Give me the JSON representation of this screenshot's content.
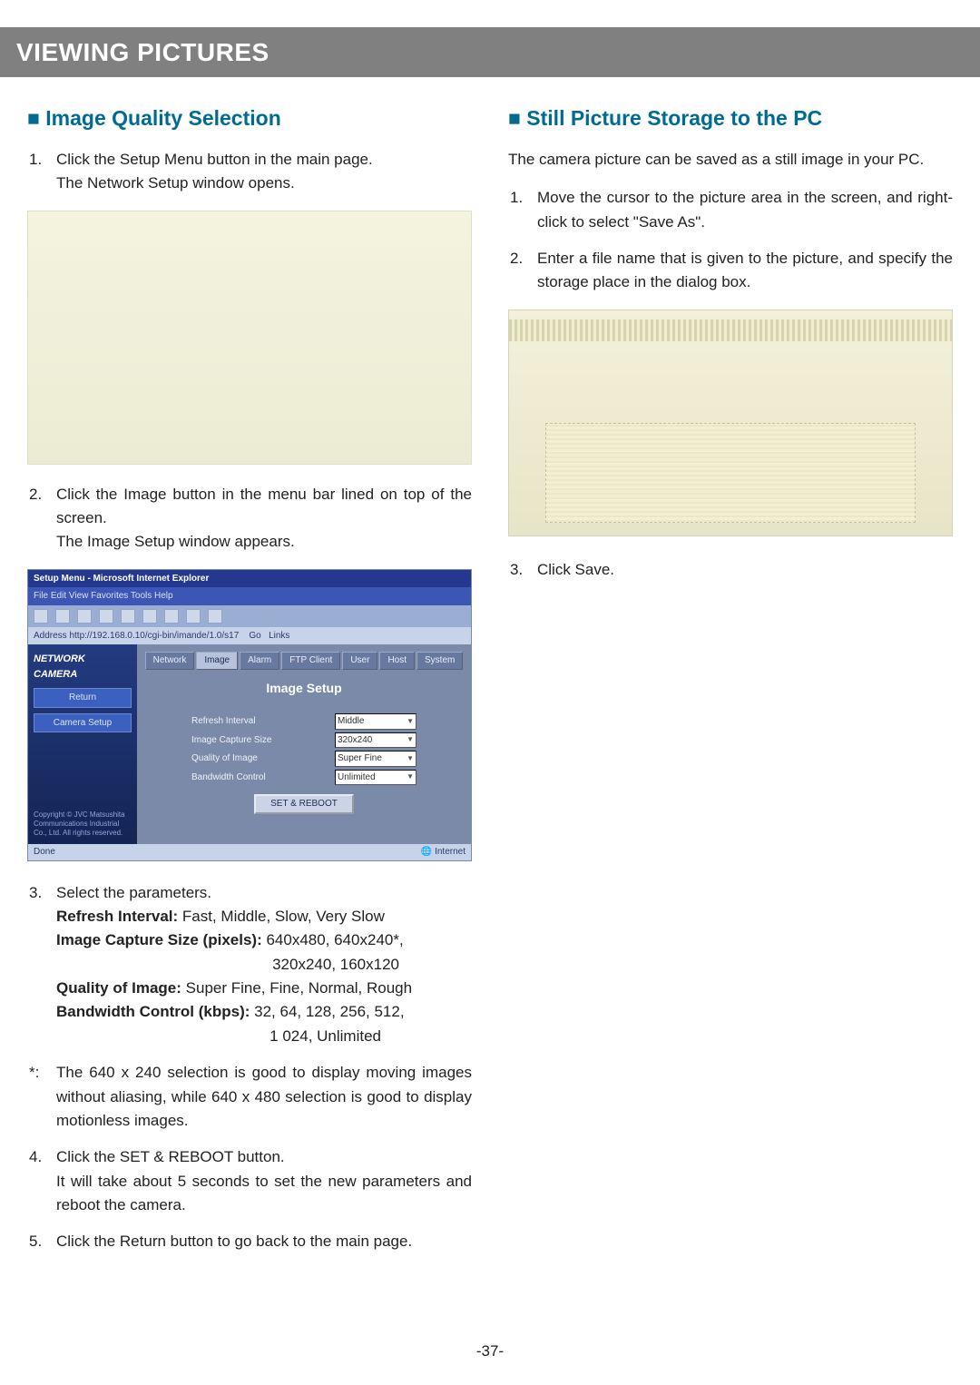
{
  "banner": "VIEWING PICTURES",
  "left": {
    "title": "■ Image Quality Selection",
    "step1": {
      "n": "1.",
      "a": "Click the Setup Menu button in the main page.",
      "b": "The Network Setup window opens."
    },
    "step2": {
      "n": "2.",
      "a": "Click the Image button in the menu bar lined on top of the screen.",
      "b": "The Image Setup window appears."
    },
    "setup_shot": {
      "title": "Setup Menu - Microsoft Internet Explorer",
      "menu": "File  Edit  View  Favorites  Tools  Help",
      "toolbar": [
        "Back",
        "Stop",
        "Refresh",
        "Home",
        "Search",
        "Favorites",
        "History",
        "Mail",
        "Print"
      ],
      "address_label": "Address",
      "address": "http://192.168.0.10/cgi-bin/imande/1.0/s17",
      "go": "Go",
      "links": "Links",
      "logo": "NETWORK CAMERA",
      "side_return": "Return",
      "side_camera": "Camera Setup",
      "side_note": "Copyright © JVC Matsushita Communications Industrial Co., Ltd. All rights reserved.",
      "tabs": [
        "Network",
        "Image",
        "Alarm",
        "FTP Client",
        "User",
        "Host",
        "System"
      ],
      "main_title": "Image Setup",
      "rows": [
        {
          "label": "Refresh Interval",
          "value": "Middle"
        },
        {
          "label": "Image Capture Size",
          "value": "320x240"
        },
        {
          "label": "Quality of Image",
          "value": "Super Fine"
        },
        {
          "label": "Bandwidth Control",
          "value": "Unlimited"
        }
      ],
      "button": "SET & REBOOT",
      "status_left": "Done",
      "status_right": "Internet"
    },
    "step3": {
      "n": "3.",
      "a": "Select the parameters.",
      "refresh_label": "Refresh Interval:",
      "refresh_vals": " Fast, Middle, Slow, Very Slow",
      "size_label": "Image Capture Size (pixels):",
      "size_vals1": " 640x480, 640x240*,",
      "size_vals2": "320x240, 160x120",
      "quality_label": "Quality of Image:",
      "quality_vals": " Super Fine, Fine, Normal, Rough",
      "bw_label": "Bandwidth Control (kbps):",
      "bw_vals1": " 32, 64, 128, 256, 512,",
      "bw_vals2": "1 024, Unlimited"
    },
    "note": {
      "n": "*:",
      "text": "The 640 x 240 selection is good to display moving images without aliasing, while 640 x 480 selection is good to display motionless images."
    },
    "step4": {
      "n": "4.",
      "a": "Click the SET & REBOOT button.",
      "b": "It will take about 5 seconds to set the new parameters and reboot the camera."
    },
    "step5": {
      "n": "5.",
      "a": "Click the Return button to go back to the main page."
    }
  },
  "right": {
    "title": "■ Still Picture Storage to the PC",
    "lead": "The camera picture can be saved as a still image in your PC.",
    "step1": {
      "n": "1.",
      "a": "Move the cursor to the picture area in the screen, and right-click to select \"Save As\"."
    },
    "step2": {
      "n": "2.",
      "a": "Enter a file name that is given to the picture, and specify the storage place in the dialog box."
    },
    "step3": {
      "n": "3.",
      "a": "Click Save."
    }
  },
  "pagenum": "-37-"
}
